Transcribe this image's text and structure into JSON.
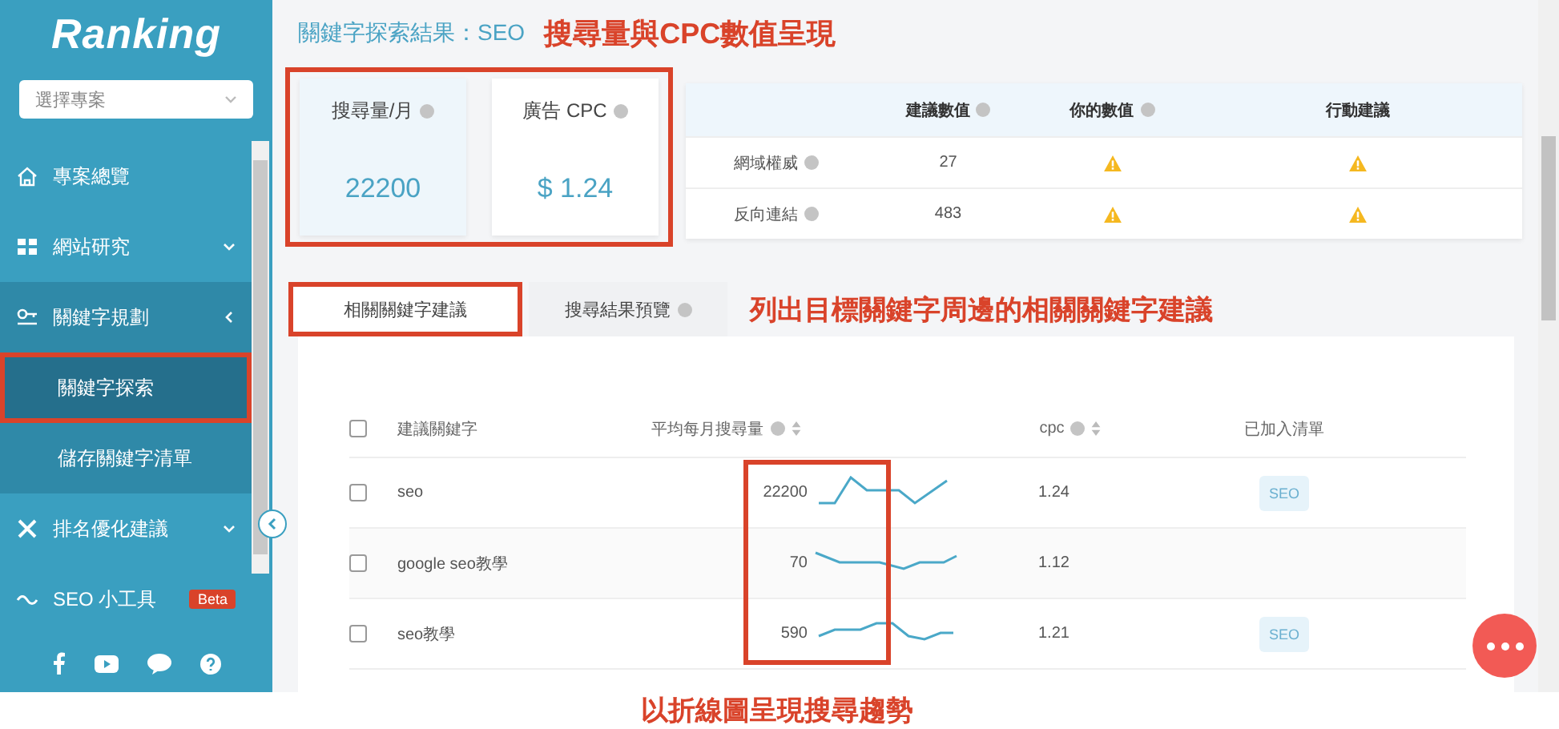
{
  "sidebar": {
    "logo": "Ranking",
    "project_select": {
      "placeholder": "選擇專案"
    },
    "items": [
      {
        "label": "專案總覽",
        "kind": "home"
      },
      {
        "label": "網站研究",
        "kind": "research",
        "expanded": false
      },
      {
        "label": "關鍵字規劃",
        "kind": "keyword",
        "expanded": true,
        "children": [
          {
            "label": "關鍵字探索",
            "selected": true
          },
          {
            "label": "儲存關鍵字清單",
            "selected": false
          }
        ]
      },
      {
        "label": "排名優化建議",
        "kind": "tools",
        "expanded": false
      },
      {
        "label": "SEO 小工具",
        "kind": "widget",
        "badge": "Beta"
      }
    ]
  },
  "main": {
    "title": "關鍵字探索結果：SEO",
    "annotation": "搜尋量與CPC數值呈現",
    "metrics": [
      {
        "label": "搜尋量/月",
        "value": "22200",
        "selected": true
      },
      {
        "label": "廣告 CPC",
        "value": "$ 1.24",
        "selected": false
      }
    ],
    "metric_table": {
      "columns": [
        {
          "label": "建議數值",
          "help": true
        },
        {
          "label": "你的數值",
          "help": true
        },
        {
          "label": "行動建議",
          "help": false
        }
      ],
      "rows": [
        {
          "label": "網域權威",
          "value": "27",
          "yours_alert": true,
          "action_alert": true
        },
        {
          "label": "反向連結",
          "value": "483",
          "yours_alert": true,
          "action_alert": true
        }
      ]
    },
    "tabs": [
      {
        "label": "相關關鍵字建議",
        "selected": true,
        "help": false
      },
      {
        "label": "搜尋結果預覽",
        "selected": false,
        "help": true
      }
    ],
    "tabs_annotation": "列出目標關鍵字周邊的相關關鍵字建議",
    "keyword_table": {
      "select_all": {
        "checked": false
      },
      "columns": [
        {
          "label": "建議關鍵字",
          "help": false,
          "sortable": false
        },
        {
          "label": "平均每月搜尋量",
          "help": true,
          "sortable": true
        },
        {
          "label": "cpc",
          "help": true,
          "sortable": true
        },
        {
          "label": "已加入清單",
          "help": false,
          "sortable": false
        }
      ],
      "rows": [
        {
          "keyword": "seo",
          "volume": "22200",
          "cpc": "1.24",
          "tag": "SEO",
          "checked": false
        },
        {
          "keyword": "google seo教學",
          "volume": "70",
          "cpc": "1.12",
          "checked": false
        },
        {
          "keyword": "seo教學",
          "volume": "590",
          "cpc": "1.21",
          "tag": "SEO",
          "checked": false
        }
      ]
    },
    "trend_annotation": "以折線圖呈現搜尋趨勢"
  }
}
